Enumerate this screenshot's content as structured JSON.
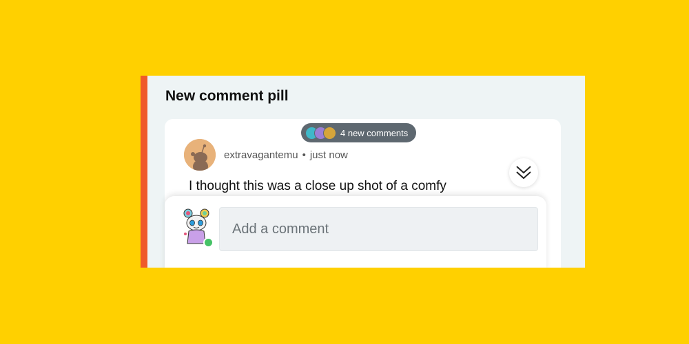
{
  "card": {
    "title": "New comment pill"
  },
  "pill": {
    "label": "4 new comments",
    "avatars": [
      "avatar-teal",
      "avatar-purple",
      "avatar-gold"
    ]
  },
  "comment": {
    "author": "extravagantemu",
    "separator": "•",
    "time": "just now",
    "text": "I thought this was a close up shot of a comfy"
  },
  "composer": {
    "placeholder": "Add a comment",
    "value": ""
  },
  "icons": {
    "jump": "double-chevron-down-icon",
    "author_avatar": "snoo-avatar-icon",
    "user_avatar": "user-snoo-avatar-icon"
  },
  "colors": {
    "background": "#FFD000",
    "accent": "#EF5A2B",
    "pill": "#5E6870",
    "online": "#46C266"
  }
}
